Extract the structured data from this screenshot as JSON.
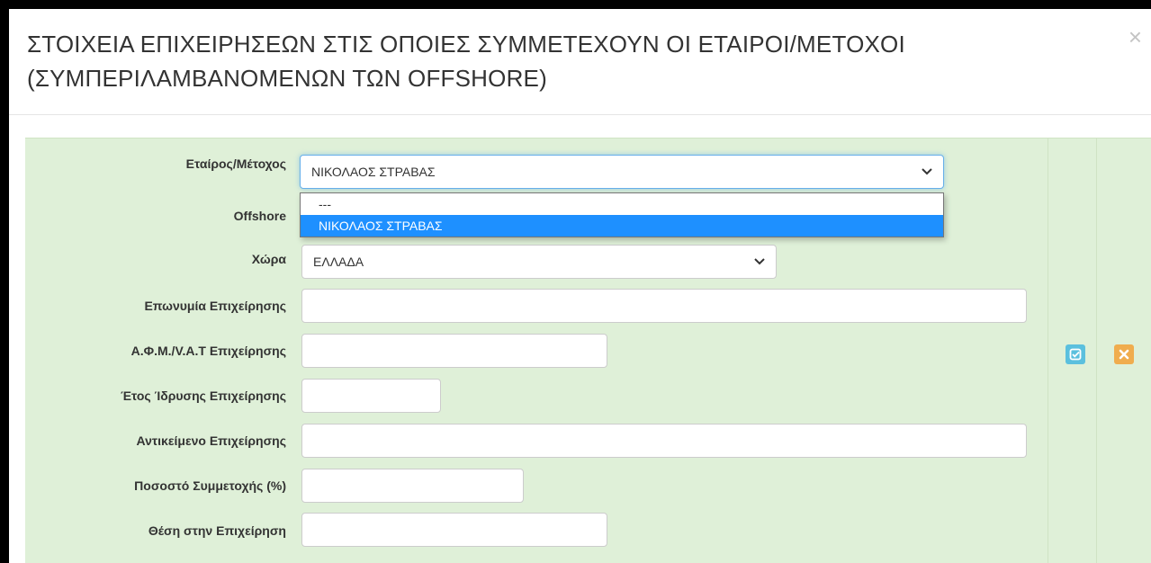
{
  "modal": {
    "title": "ΣΤΟΙΧΕΙΑ ΕΠΙΧΕΙΡΗΣΕΩΝ ΣΤΙΣ ΟΠΟΙΕΣ ΣΥΜΜΕΤΕΧΟΥΝ ΟΙ ΕΤΑΙΡΟΙ/ΜΕΤΟΧΟΙ (ΣΥΜΠΕΡΙΛΑΜΒΑΝΟΜΕΝΩΝ ΤΩΝ OFFSHORE)",
    "close_label": "×"
  },
  "form": {
    "partner_label": "Εταίρος/Μέτοχος",
    "partner_value": "ΝΙΚΟΛΑΟΣ ΣΤΡΑΒΑΣ",
    "partner_options": [
      "---",
      "ΝΙΚΟΛΑΟΣ ΣΤΡΑΒΑΣ"
    ],
    "offshore_label": "Offshore",
    "country_label": "Χώρα",
    "country_value": "ΕΛΛΑΔΑ",
    "company_name_label": "Επωνυμία Επιχείρησης",
    "company_name_value": "",
    "vat_label": "Α.Φ.Μ./V.A.T Επιχείρησης",
    "vat_value": "",
    "founded_label": "Έτος Ίδρυσης Επιχείρησης",
    "founded_value": "",
    "object_label": "Αντικείμενο Επιχείρησης",
    "object_value": "",
    "share_label": "Ποσοστό Συμμετοχής (%)",
    "share_value": "",
    "position_label": "Θέση στην Επιχείρηση",
    "position_value": ""
  },
  "actions": {
    "save_icon": "check-square-icon",
    "cancel_icon": "close-x-icon"
  },
  "colors": {
    "row_bg": "#dff0d8",
    "save_btn": "#5bc0de",
    "cancel_btn": "#f0ad4e",
    "option_highlight": "#1e90ff"
  }
}
